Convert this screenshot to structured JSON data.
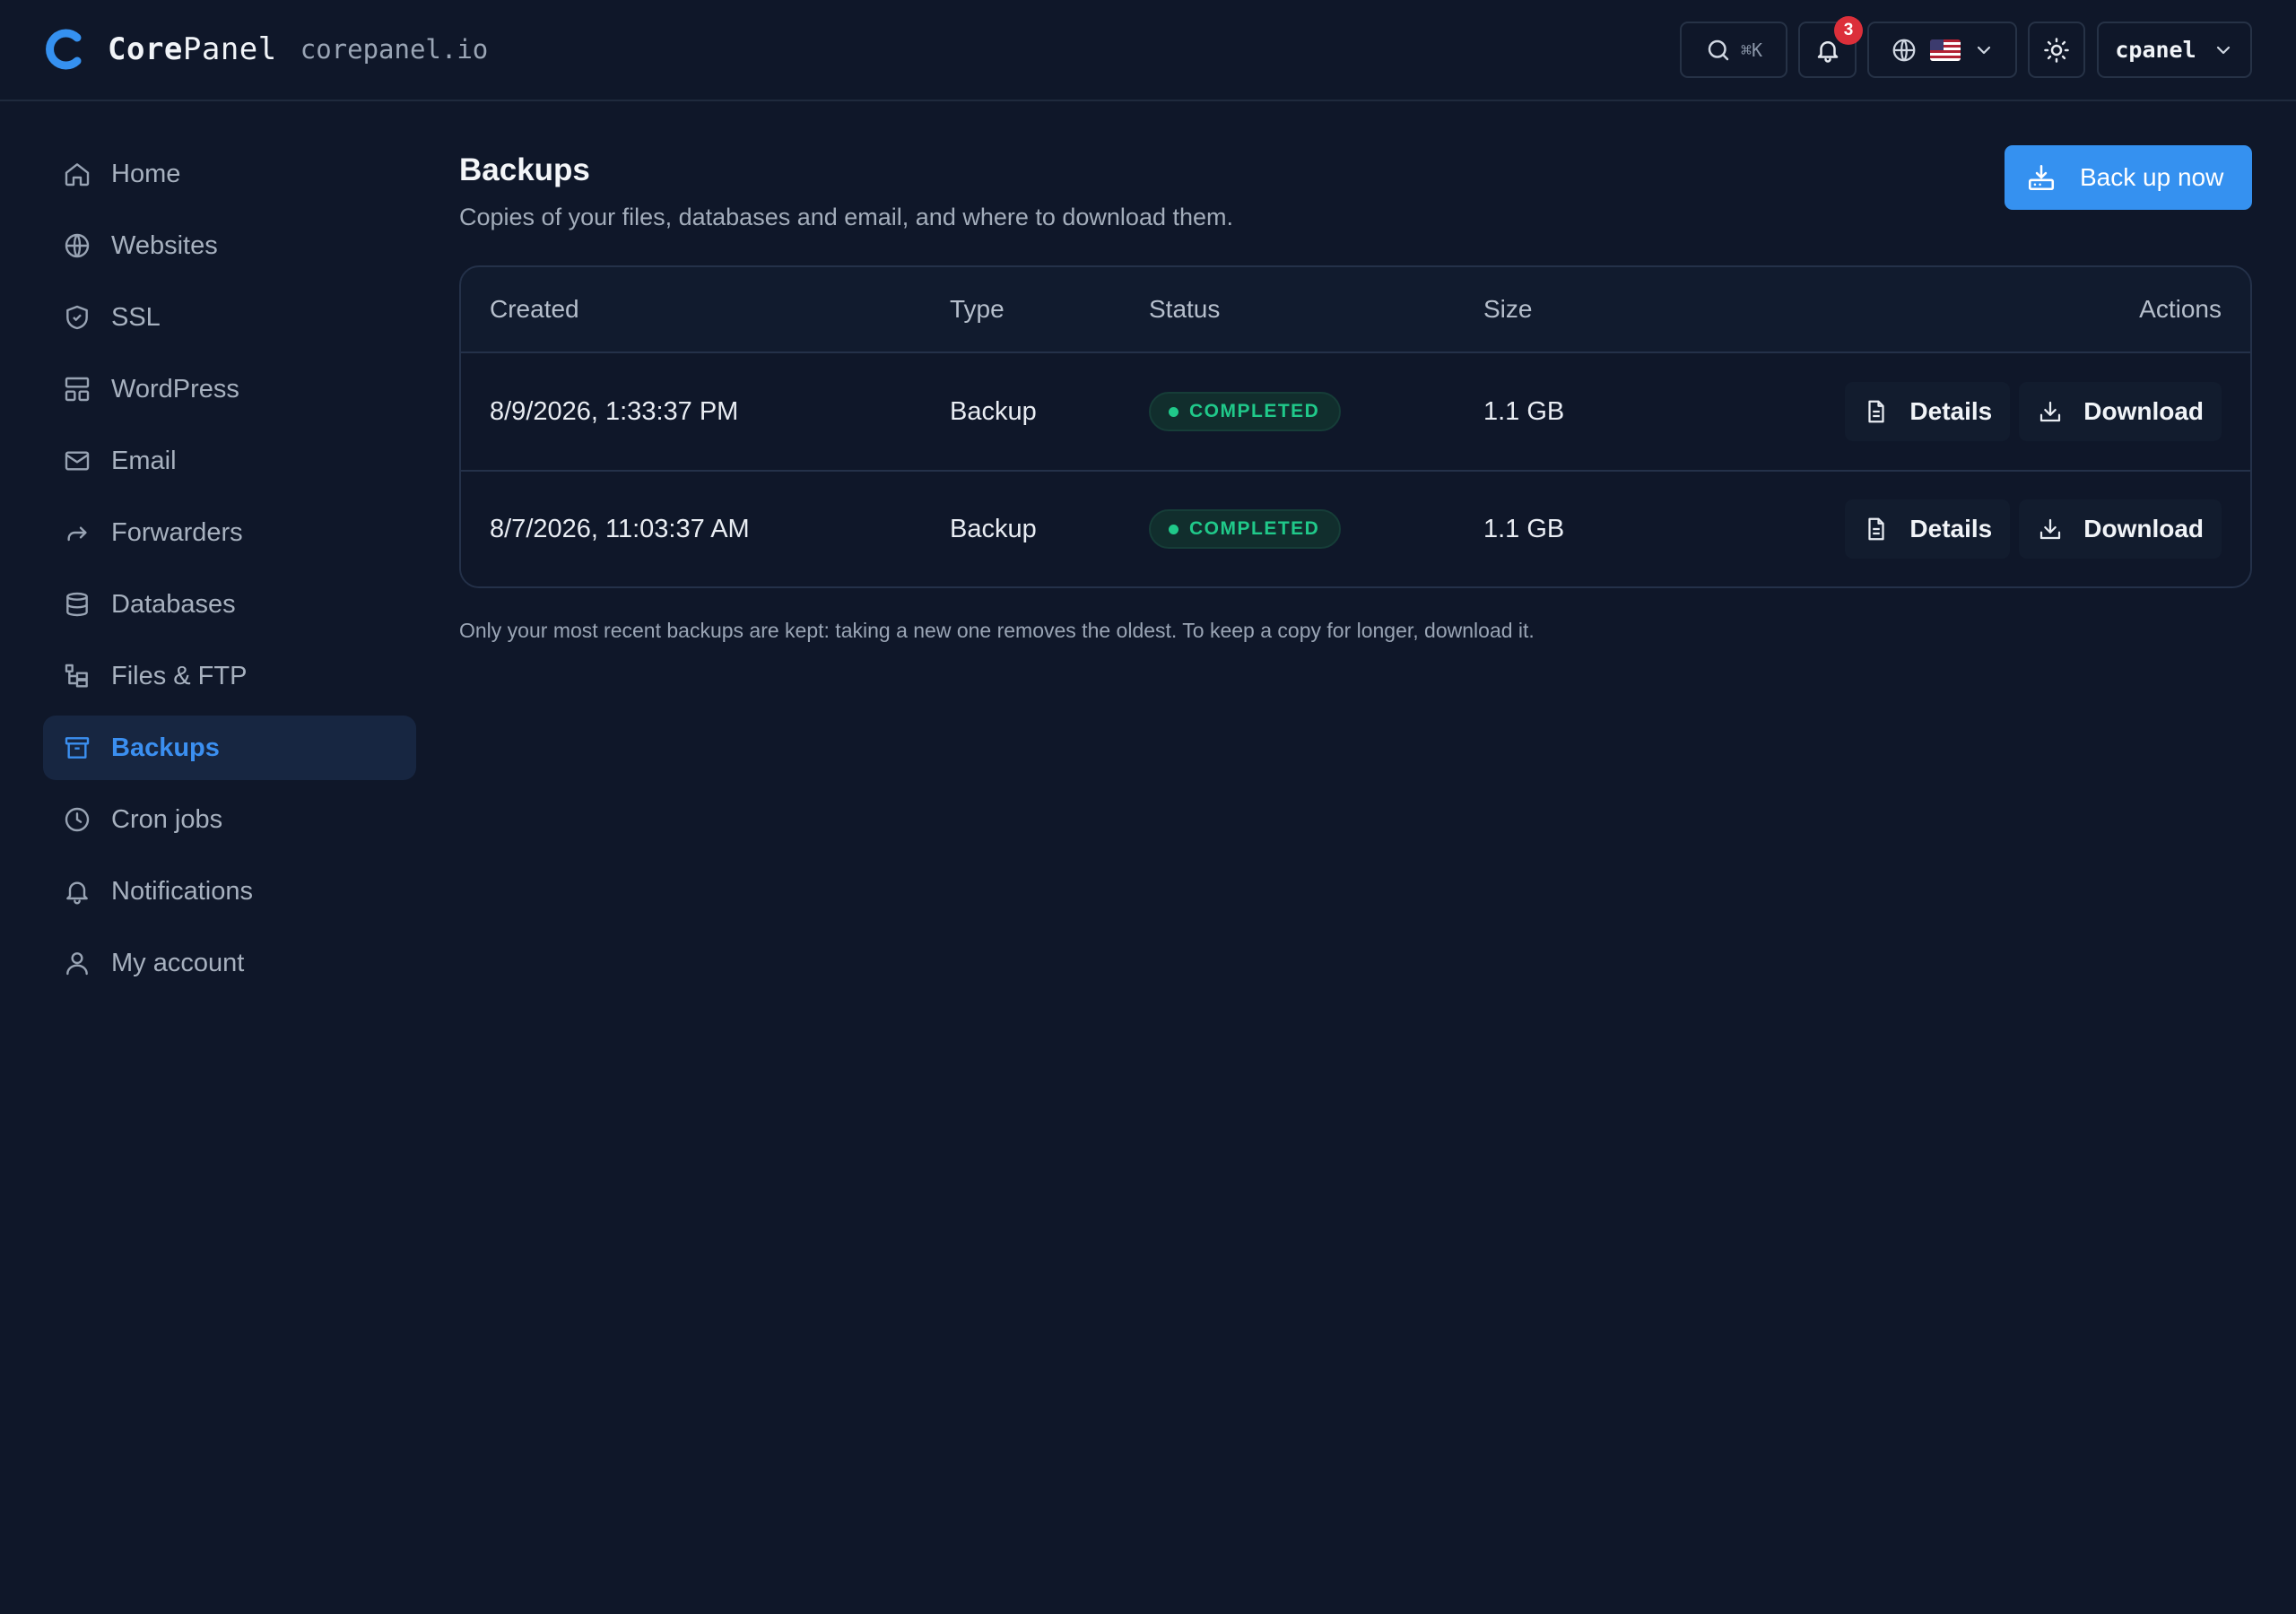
{
  "header": {
    "brand_bold": "Core",
    "brand_rest": "Panel",
    "domain": "corepanel.io",
    "search_shortcut": "⌘K",
    "notification_count": "3",
    "user": "cpanel",
    "accent_color": "#3591f0"
  },
  "sidebar": {
    "items": [
      {
        "label": "Home",
        "icon": "home-icon"
      },
      {
        "label": "Websites",
        "icon": "globe-icon"
      },
      {
        "label": "SSL",
        "icon": "shield-icon"
      },
      {
        "label": "WordPress",
        "icon": "layout-icon"
      },
      {
        "label": "Email",
        "icon": "mail-icon"
      },
      {
        "label": "Forwarders",
        "icon": "forward-icon"
      },
      {
        "label": "Databases",
        "icon": "database-icon"
      },
      {
        "label": "Files & FTP",
        "icon": "folder-tree-icon"
      },
      {
        "label": "Backups",
        "icon": "archive-icon",
        "active": true
      },
      {
        "label": "Cron jobs",
        "icon": "clock-icon"
      },
      {
        "label": "Notifications",
        "icon": "bell-icon"
      },
      {
        "label": "My account",
        "icon": "user-icon"
      }
    ]
  },
  "main": {
    "title": "Backups",
    "subtitle": "Copies of your files, databases and email, and where to download them.",
    "primary_action": "Back up now",
    "table": {
      "columns": [
        "Created",
        "Type",
        "Status",
        "Size",
        "Actions"
      ],
      "rows": [
        {
          "created": "8/9/2026, 1:33:37 PM",
          "type": "Backup",
          "status": "COMPLETED",
          "size": "1.1 GB",
          "details": "Details",
          "download": "Download"
        },
        {
          "created": "8/7/2026, 11:03:37 AM",
          "type": "Backup",
          "status": "COMPLETED",
          "size": "1.1 GB",
          "details": "Details",
          "download": "Download"
        }
      ]
    },
    "footnote": "Only your most recent backups are kept: taking a new one removes the oldest. To keep a copy for longer, download it.",
    "status_color": "#20c98a"
  }
}
